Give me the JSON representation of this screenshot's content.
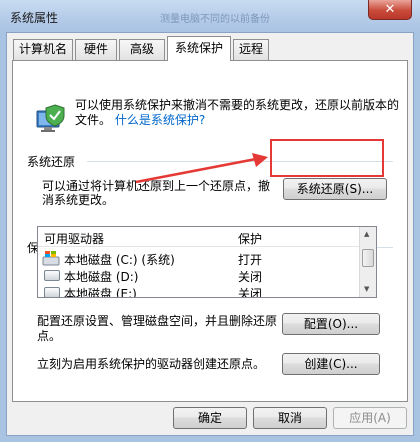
{
  "window": {
    "title": "系统属性",
    "ghost_text": "测量电脑不同的以前备份",
    "close_glyph": "✕"
  },
  "tabs": [
    {
      "label": "计算机名",
      "active": false
    },
    {
      "label": "硬件",
      "active": false
    },
    {
      "label": "高级",
      "active": false
    },
    {
      "label": "系统保护",
      "active": true
    },
    {
      "label": "远程",
      "active": false
    }
  ],
  "intro": {
    "text": "可以使用系统保护来撤消不需要的系统更改，还原以前版本的文件。",
    "link": "什么是系统保护?",
    "icon": "system-protection-icon"
  },
  "restore": {
    "heading": "系统还原",
    "text": "可以通过将计算机还原到上一个还原点，撤消系统更改。",
    "button": "系统还原(S)..."
  },
  "protection": {
    "heading": "保护设置",
    "columns": [
      "可用驱动器",
      "保护"
    ],
    "rows": [
      {
        "drive": "本地磁盘 (C:) (系统)",
        "status": "打开",
        "icon": "windows-drive-icon"
      },
      {
        "drive": "本地磁盘 (D:)",
        "status": "关闭",
        "icon": "drive-icon"
      },
      {
        "drive": "本地磁盘 (E:)",
        "status": "关闭",
        "icon": "drive-icon"
      }
    ],
    "configure_text": "配置还原设置、管理磁盘空间，并且删除还原点。",
    "configure_button": "配置(O)...",
    "create_text": "立刻为启用系统保护的驱动器创建还原点。",
    "create_button": "创建(C)..."
  },
  "footer": {
    "ok": "确定",
    "cancel": "取消",
    "apply": "应用(A)"
  },
  "colors": {
    "highlight": "#e53935",
    "link": "#0066cc"
  }
}
